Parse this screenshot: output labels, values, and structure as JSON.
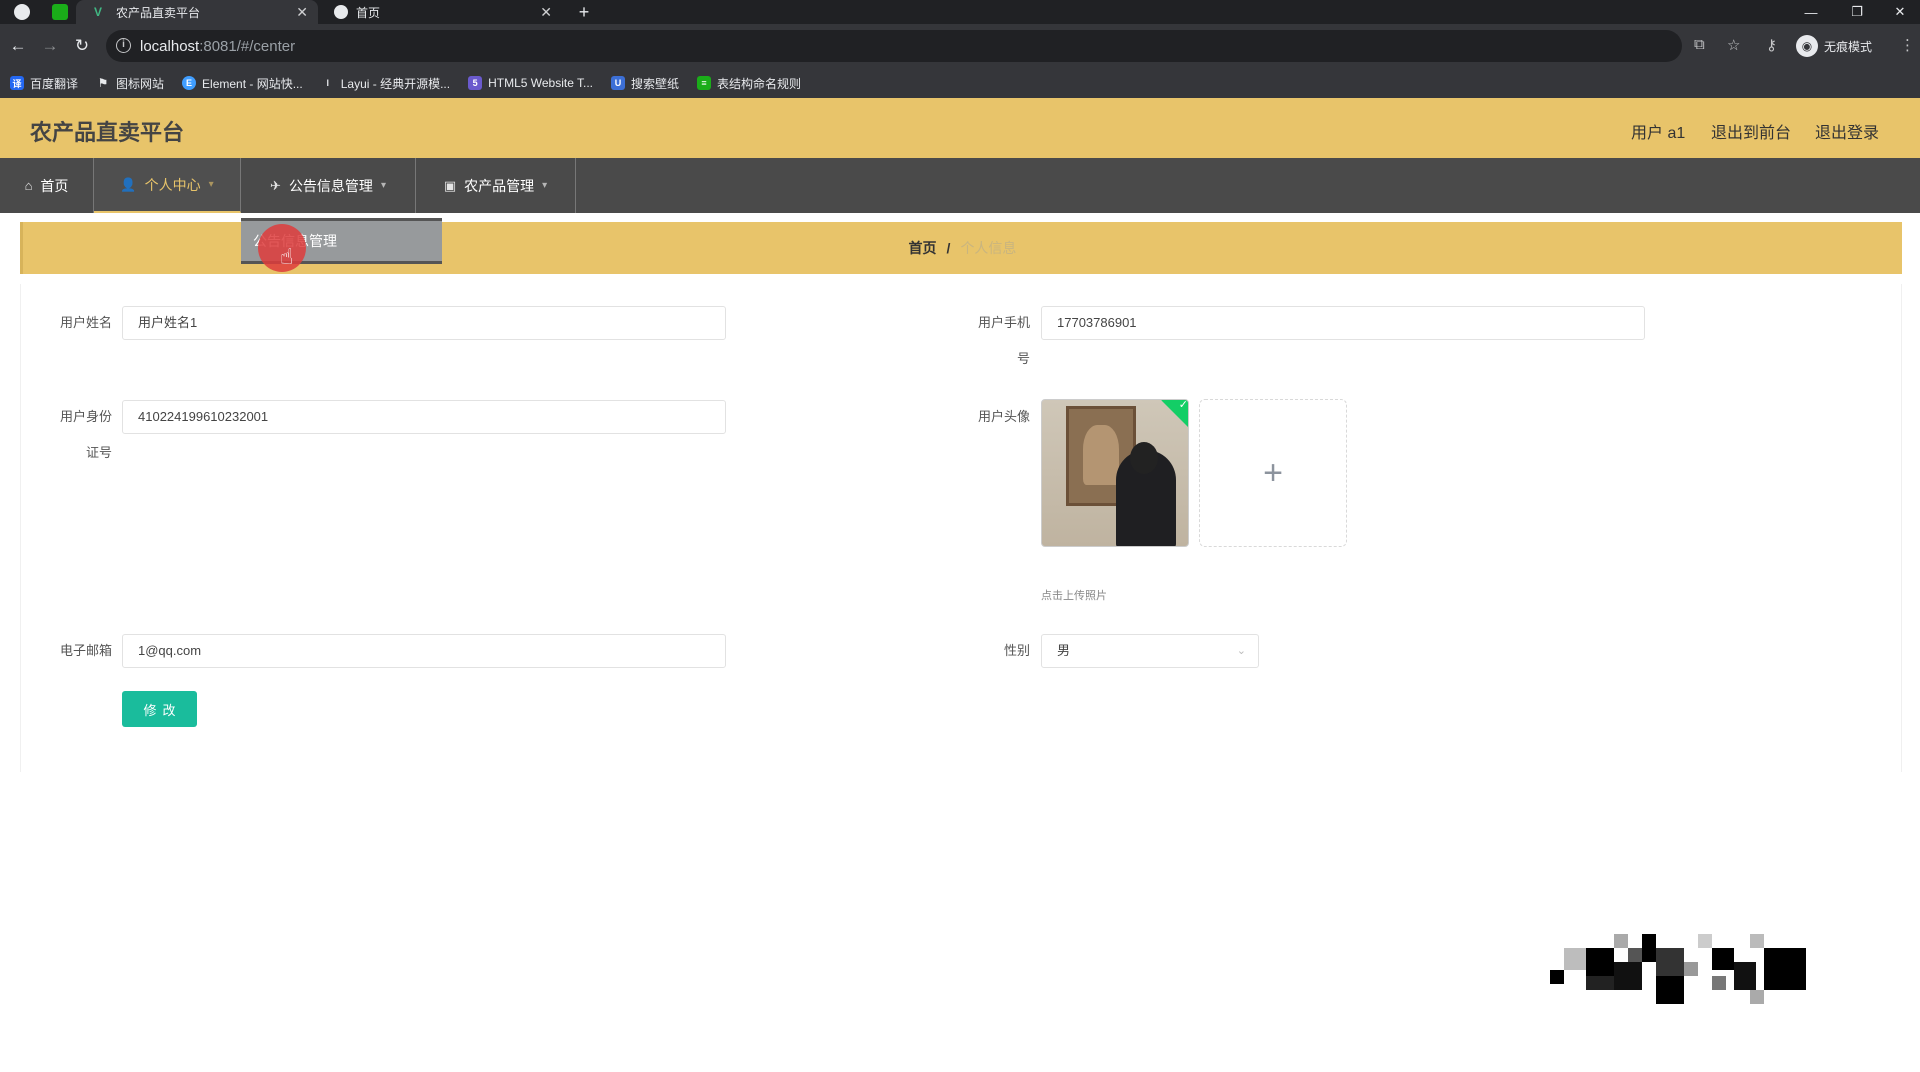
{
  "browser": {
    "tabs": [
      {
        "title": "农产品直卖平台",
        "active": true
      },
      {
        "title": "首页",
        "active": false
      }
    ],
    "url_host": "localhost",
    "url_rest": ":8081/#/center",
    "profile_label": "无痕模式",
    "bookmarks": [
      {
        "label": "百度翻译",
        "icon": "translate-icon",
        "color": "#2468f2"
      },
      {
        "label": "图标网站",
        "icon": "flag-icon",
        "color": "#e8eaed"
      },
      {
        "label": "Element - 网站快...",
        "icon": "element-icon",
        "color": "#409eff"
      },
      {
        "label": "Layui - 经典开源模...",
        "icon": "layui-icon",
        "color": "#e8eaed"
      },
      {
        "label": "HTML5 Website T...",
        "icon": "html5-icon",
        "color": "#6a5acd"
      },
      {
        "label": "搜索壁纸",
        "icon": "wallpaper-icon",
        "color": "#3c6fd6"
      },
      {
        "label": "表结构命名规则",
        "icon": "table-icon",
        "color": "#1aad19"
      }
    ]
  },
  "app": {
    "brand": "农产品直卖平台",
    "header_links": [
      "用户 a1",
      "退出到前台",
      "退出登录"
    ],
    "menu": [
      {
        "label": "首页",
        "icon": "home-icon"
      },
      {
        "label": "个人中心",
        "icon": "user-icon"
      },
      {
        "label": "公告信息管理",
        "icon": "megaphone-icon"
      },
      {
        "label": "农产品管理",
        "icon": "box-icon"
      }
    ],
    "dropdown_item": "公告信息管理",
    "breadcrumb": {
      "home": "首页",
      "separator": "/",
      "current": "个人信息"
    },
    "accent_color": "#e8c46a",
    "button_color": "#1abc9c"
  },
  "form": {
    "name_label": "用户姓名",
    "name_value": "用户姓名1",
    "phone_label_1": "用户手机",
    "phone_label_2": "号",
    "phone_value": "17703786901",
    "id_label_1": "用户身份",
    "id_label_2": "证号",
    "id_value": "410224199610232001",
    "avatar_label": "用户头像",
    "upload_tip": "点击上传照片",
    "email_label": "电子邮箱",
    "email_value": "1@qq.com",
    "gender_label": "性别",
    "gender_value": "男",
    "submit_label": "修改"
  }
}
